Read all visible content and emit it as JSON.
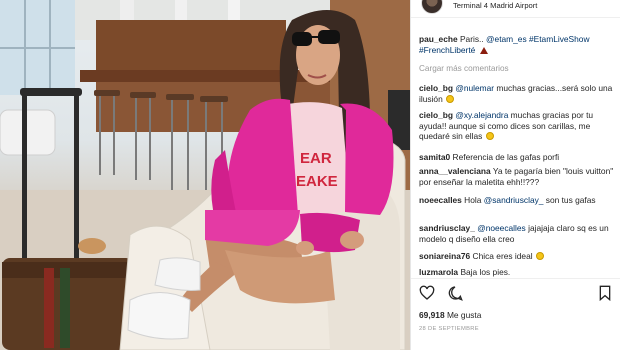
{
  "post": {
    "location": "Terminal 4 Madrid Airport",
    "load_more": "Cargar más comentarios",
    "likes_count": "69,918",
    "likes_suffix": "Me gusta",
    "date": "28 DE SEPTIEMBRE"
  },
  "photo": {
    "shirt_text_line1": "EAR",
    "shirt_text_line2": "EAKE"
  },
  "comments": [
    {
      "user": "pau_eche",
      "text": "Paris.. ",
      "mention": "@etam_es",
      "tail": " #EtamLiveShow #FrenchLiberté",
      "emoji": "triangle"
    },
    {
      "user": "cielo_bg",
      "text": "",
      "mention": "@nulemar",
      "tail": " muchas gracias...será solo una ilusión",
      "emoji": "smile"
    },
    {
      "user": "cielo_bg",
      "text": "",
      "mention": "@xy.alejandra",
      "tail": " muchas gracias por tu ayuda!! aunque si como dices son carillas, me quedaré sin ellas",
      "emoji": "smile"
    },
    {
      "user": "samita0",
      "text": "Referencia de las gafas porfi",
      "mention": "",
      "tail": "",
      "emoji": ""
    },
    {
      "user": "anna__valenciana",
      "text": "Ya te pagaría bien \"louis vuitton\" por enseñar la maletita ehh!!???",
      "mention": "",
      "tail": "",
      "emoji": ""
    },
    {
      "user": "noeecalles",
      "text": "Hola ",
      "mention": "@sandriusclay_",
      "tail": " son tus gafas",
      "emoji": ""
    },
    {
      "user": "sandriusclay_",
      "text": "",
      "mention": "@noeecalles",
      "tail": " jajajaja claro sq es un modelo q diseño ella creo",
      "emoji": ""
    },
    {
      "user": "soniareina76",
      "text": "Chica eres ideal",
      "mention": "",
      "tail": "",
      "emoji": "smile"
    },
    {
      "user": "luzmarola",
      "text": "Baja los pies.",
      "mention": "",
      "tail": "",
      "emoji": ""
    }
  ],
  "icons": {
    "like": "heart-icon",
    "comment": "comment-icon",
    "save": "bookmark-icon"
  },
  "colors": {
    "jacket": "#e0299a",
    "shirt": "#f6d5dc",
    "shirt_text": "#d0263e",
    "mention": "#003569"
  }
}
